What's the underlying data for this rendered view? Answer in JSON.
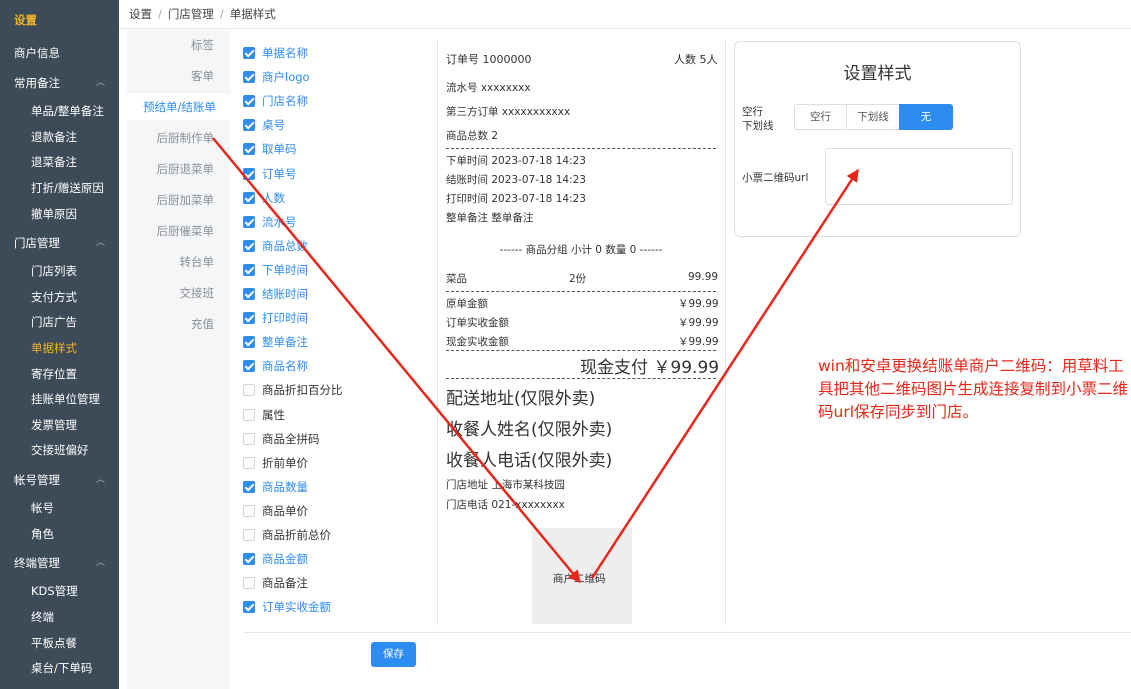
{
  "sidebar": {
    "brand": "设置",
    "items": [
      {
        "label": "商户信息"
      },
      {
        "label": "常用备注"
      },
      {
        "label": "单品/整单备注"
      },
      {
        "label": "退款备注"
      },
      {
        "label": "退菜备注"
      },
      {
        "label": "打折/赠送原因"
      },
      {
        "label": "撤单原因"
      },
      {
        "label": "门店管理"
      },
      {
        "label": "门店列表"
      },
      {
        "label": "支付方式"
      },
      {
        "label": "门店广告"
      },
      {
        "label": "单据样式"
      },
      {
        "label": "寄存位置"
      },
      {
        "label": "挂账单位管理"
      },
      {
        "label": "发票管理"
      },
      {
        "label": "交接班偏好"
      },
      {
        "label": "帐号管理"
      },
      {
        "label": "帐号"
      },
      {
        "label": "角色"
      },
      {
        "label": "终端管理"
      },
      {
        "label": "KDS管理"
      },
      {
        "label": "终端"
      },
      {
        "label": "平板点餐"
      },
      {
        "label": "桌台/下单码"
      }
    ]
  },
  "breadcrumb": [
    "设置",
    "门店管理",
    "单据样式"
  ],
  "tabs": [
    "标签",
    "客单",
    "预结单/结账单",
    "后厨制作单",
    "后厨退菜单",
    "后厨加菜单",
    "后厨催菜单",
    "转台单",
    "交接班",
    "充值"
  ],
  "fields": [
    {
      "label": "单据名称",
      "checked": true
    },
    {
      "label": "商户logo",
      "checked": true
    },
    {
      "label": "门店名称",
      "checked": true
    },
    {
      "label": "桌号",
      "checked": true
    },
    {
      "label": "取单码",
      "checked": true
    },
    {
      "label": "订单号",
      "checked": true
    },
    {
      "label": "人数",
      "checked": true
    },
    {
      "label": "流水号",
      "checked": true
    },
    {
      "label": "商品总数",
      "checked": true
    },
    {
      "label": "下单时间",
      "checked": true
    },
    {
      "label": "结账时间",
      "checked": true
    },
    {
      "label": "打印时间",
      "checked": true
    },
    {
      "label": "整单备注",
      "checked": true
    },
    {
      "label": "商品名称",
      "checked": true
    },
    {
      "label": "商品折扣百分比",
      "checked": false
    },
    {
      "label": "属性",
      "checked": false
    },
    {
      "label": "商品全拼码",
      "checked": false
    },
    {
      "label": "折前单价",
      "checked": false
    },
    {
      "label": "商品数量",
      "checked": true
    },
    {
      "label": "商品单价",
      "checked": false
    },
    {
      "label": "商品折前总价",
      "checked": false
    },
    {
      "label": "商品金额",
      "checked": true
    },
    {
      "label": "商品备注",
      "checked": false
    },
    {
      "label": "订单实收金额",
      "checked": true
    }
  ],
  "receipt": {
    "order_no": "订单号 1000000",
    "people": "人数 5人",
    "serial": "流水号 xxxxxxxx",
    "third_party": "第三方订单 xxxxxxxxxxx",
    "total_items": "商品总数 2",
    "order_time": "下单时间 2023-07-18 14:23",
    "checkout_time": "结账时间 2023-07-18 14:23",
    "print_time": "打印时间 2023-07-18 14:23",
    "order_note": "整单备注 整单备注",
    "group_line": "------ 商品分组 小计 0 数量 0 ------",
    "item_name": "菜品",
    "item_qty": "2份",
    "item_price": "99.99",
    "rows": [
      {
        "label": "原单金额",
        "value": "￥99.99"
      },
      {
        "label": "订单实收金额",
        "value": "￥99.99"
      },
      {
        "label": "现金实收金额",
        "value": "￥99.99"
      }
    ],
    "payment": "现金支付 ￥99.99",
    "delivery_address": "配送地址(仅限外卖)",
    "receiver_name": "收餐人姓名(仅限外卖)",
    "receiver_phone": "收餐人电话(仅限外卖)",
    "store_address": "门店地址 上海市某科技园",
    "store_phone": "门店电话 021-xxxxxxxx",
    "qr_label": "商户二维码"
  },
  "style_panel": {
    "title": "设置样式",
    "line_label_1": "空行",
    "line_label_2": "下划线",
    "options": [
      "空行",
      "下划线",
      "无"
    ],
    "selected": "无",
    "qr_url_label": "小票二维码url",
    "qr_url_value": ""
  },
  "save_label": "保存",
  "annotation": "win和安卓更换结账单商户二维码：用草料工具把其他二维码图片生成连接复制到小票二维码url保存同步到门店。",
  "colors": {
    "sidebar_bg": "#3d4a58",
    "accent": "#2d8cf0",
    "active_menu": "#f0b429",
    "annotation": "#e8261a"
  }
}
